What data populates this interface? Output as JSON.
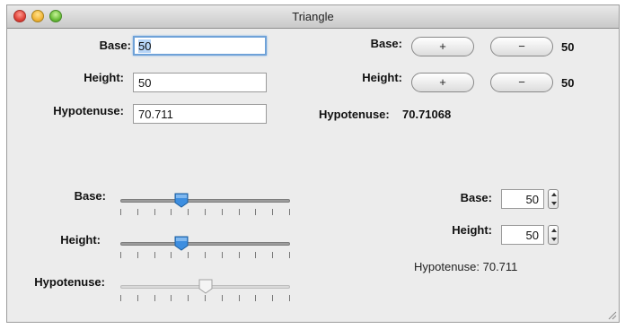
{
  "window": {
    "title": "Triangle",
    "controls": [
      "close-button",
      "minimize-button",
      "zoom-button"
    ]
  },
  "text_fields_panel": {
    "base_label": "Base:",
    "base_value": "50",
    "height_label": "Height:",
    "height_value": "50",
    "hypotenuse_label": "Hypotenuse:",
    "hypotenuse_value": "70.711"
  },
  "buttons_panel": {
    "base_label": "Base:",
    "base_plus": "+",
    "base_minus": "−",
    "base_value": "50",
    "height_label": "Height:",
    "height_plus": "+",
    "height_minus": "−",
    "height_value": "50",
    "hypotenuse_label": "Hypotenuse:",
    "hypotenuse_value": "70.71068"
  },
  "sliders_panel": {
    "base_label": "Base:",
    "base_level": 0.36,
    "height_label": "Height:",
    "height_level": 0.36,
    "hypotenuse_label": "Hypotenuse:",
    "hypotenuse_level": 0.5,
    "hypotenuse_enabled": false
  },
  "spinners_panel": {
    "base_label": "Base:",
    "base_value": "50",
    "height_label": "Height:",
    "height_value": "50",
    "hypotenuse_text": "Hypotenuse: 70.711"
  },
  "colors": {
    "focus_ring": "#6fa2d8",
    "selection": "#b6d4f6",
    "slider_thumb_active": "#3d8ee0"
  }
}
